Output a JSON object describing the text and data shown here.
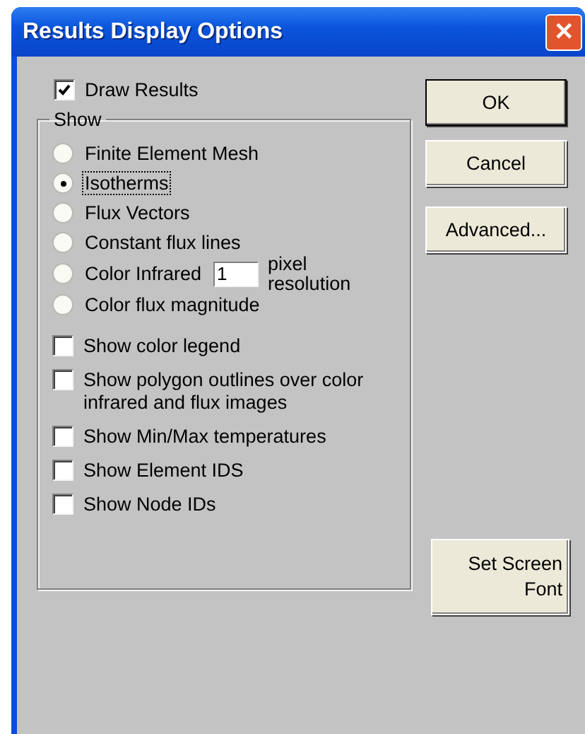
{
  "window": {
    "title": "Results Display Options",
    "close": "✕"
  },
  "draw_results": {
    "label": "Draw Results",
    "checked": true
  },
  "group": {
    "title": "Show",
    "radios": [
      {
        "kind": "plain",
        "label": "Finite Element Mesh",
        "selected": false,
        "focused": false
      },
      {
        "kind": "plain",
        "label": "Isotherms",
        "selected": true,
        "focused": true
      },
      {
        "kind": "plain",
        "label": "Flux Vectors",
        "selected": false,
        "focused": false
      },
      {
        "kind": "plain",
        "label": "Constant flux lines",
        "selected": false,
        "focused": false
      },
      {
        "kind": "with_field",
        "label": "Color Infrared",
        "value": "1",
        "suffix": "pixel resolution",
        "selected": false,
        "focused": false
      },
      {
        "kind": "plain",
        "label": "Color flux magnitude",
        "selected": false,
        "focused": false
      }
    ],
    "checkboxes": [
      {
        "label": "Show color legend",
        "checked": false
      },
      {
        "label": "Show polygon outlines over color infrared and flux images",
        "checked": false
      },
      {
        "label": "Show Min/Max temperatures",
        "checked": false
      },
      {
        "label": "Show Element IDS",
        "checked": false
      },
      {
        "label": "Show Node IDs",
        "checked": false
      }
    ]
  },
  "buttons": [
    {
      "label": "OK",
      "default": true
    },
    {
      "label": "Cancel",
      "default": false
    },
    {
      "label": "Advanced...",
      "default": false
    }
  ],
  "font_button": {
    "label": "Set Screen Font"
  }
}
